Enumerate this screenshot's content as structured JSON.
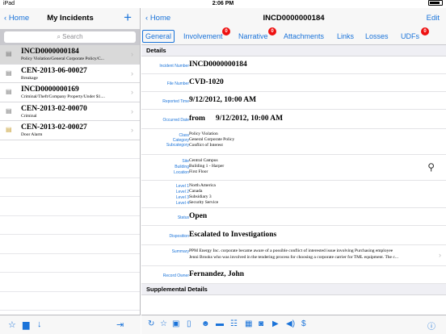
{
  "status_bar": {
    "carrier": "iPad",
    "time": "2:06 PM"
  },
  "left": {
    "back_label": "Home",
    "title": "My Incidents",
    "add_icon": "plus-icon",
    "search_placeholder": "Search",
    "incidents": [
      {
        "number": "INCD0000000184",
        "subtitle": "Policy Violation/General Corporate Policy/C...",
        "selected": true
      },
      {
        "number": "CEN-2013-06-00027",
        "subtitle": "Breakage"
      },
      {
        "number": "INCD0000000169",
        "subtitle": "Criminal/Theft/Company Property/Under $1...."
      },
      {
        "number": "CEN-2013-02-00070",
        "subtitle": "Criminal"
      },
      {
        "number": "CEN-2013-02-00027",
        "subtitle": "Door Alarm"
      }
    ]
  },
  "right": {
    "back_label": "Home",
    "title": "INCD0000000184",
    "edit_label": "Edit",
    "tabs": [
      {
        "label": "General",
        "active": true
      },
      {
        "label": "Involvement",
        "badge": "0"
      },
      {
        "label": "Narrative",
        "badge": "0"
      },
      {
        "label": "Attachments"
      },
      {
        "label": "Links"
      },
      {
        "label": "Losses"
      },
      {
        "label": "UDFs",
        "badge": "0"
      }
    ],
    "details_header": "Details",
    "fields": {
      "incident_number_label": "Incident Number",
      "incident_number": "INCD0000000184",
      "file_number_label": "File Number",
      "file_number": "CVD-1020",
      "reported_time_label": "Reported Time",
      "reported_time": "9/12/2012, 10:00 AM",
      "occurred_date_label": "Occurred Date",
      "occurred_from": "from",
      "occurred_date": "9/12/2012, 10:00 AM",
      "class_label": "Class",
      "category_label": "Category",
      "subcategory_label": "Subcategory",
      "class": "Policy Violation",
      "category": "General Corporate Policy",
      "subcategory": "Conflict of Interest",
      "site_label": "Site",
      "building_label": "Building",
      "location_label": "Location",
      "site": "Central Campus",
      "building": "Building 1 - Harper",
      "location": "First Floor",
      "level1_label": "Level 1",
      "level2_label": "Level 2",
      "level3_label": "Level 3",
      "level4_label": "Level 4",
      "level1": "North America",
      "level2": "Canada",
      "level3": "Subsidiary 3",
      "level4": "Security Service",
      "status_label": "Status",
      "status": "Open",
      "disposition_label": "Disposition",
      "disposition": "Escalated to Investigations",
      "summary_label": "Summary",
      "summary_line1": "PPM Energy Inc. corporate became aware of a possible conflict of interested issue involving Purchasing employee",
      "summary_line2": "Jenni Brooks who was involved in the tendering process for choosing a corporate carrier for TML equipment.  The c...",
      "record_owner_label": "Record Owner",
      "record_owner": "Fernandez, John"
    },
    "supplemental_header": "Supplemental Details"
  }
}
